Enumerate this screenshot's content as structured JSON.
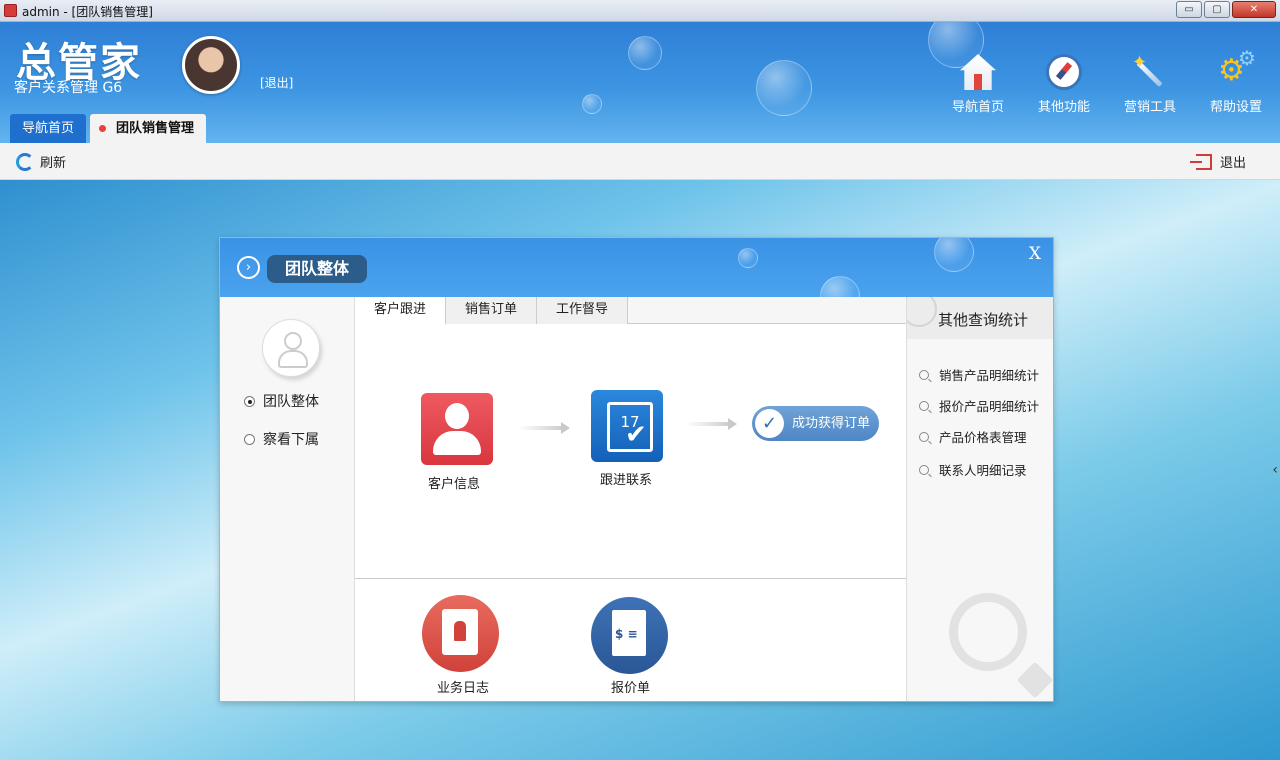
{
  "window": {
    "title": "admin - [团队销售管理]",
    "controls": {
      "minimize": "▭",
      "maximize": "▢",
      "close": "✕"
    }
  },
  "header": {
    "brand": "总管家",
    "subtitle": "客户关系管理 G6",
    "logout_link": "[退出]",
    "nav": [
      {
        "label": "导航首页",
        "icon": "home-icon"
      },
      {
        "label": "其他功能",
        "icon": "compass-icon"
      },
      {
        "label": "营销工具",
        "icon": "magic-wand-icon"
      },
      {
        "label": "帮助设置",
        "icon": "gear-icon"
      }
    ],
    "tabs": [
      {
        "label": "导航首页",
        "active": false
      },
      {
        "label": "团队销售管理",
        "active": true
      }
    ]
  },
  "toolbar": {
    "refresh_label": "刷新",
    "exit_label": "退出"
  },
  "dialog": {
    "title": "团队整体",
    "close": "X",
    "view_options": [
      {
        "label": "团队整体",
        "selected": true
      },
      {
        "label": "察看下属",
        "selected": false
      }
    ],
    "tabs": [
      {
        "label": "客户跟进",
        "active": true
      },
      {
        "label": "销售订单",
        "active": false
      },
      {
        "label": "工作督导",
        "active": false
      }
    ],
    "flow": {
      "step1": "客户信息",
      "step2": "跟进联系",
      "result": "成功获得订单"
    },
    "bottom_items": [
      "业务日志",
      "报价单"
    ],
    "right_panel": {
      "title": "其他查询统计",
      "items": [
        "销售产品明细统计",
        "报价产品明细统计",
        "产品价格表管理",
        "联系人明细记录"
      ]
    }
  },
  "colors": {
    "header_blue": "#3d95e2",
    "accent_red": "#d9363f",
    "accent_blue": "#1460b8",
    "dialog_title_bg": "#2c5d8a"
  }
}
